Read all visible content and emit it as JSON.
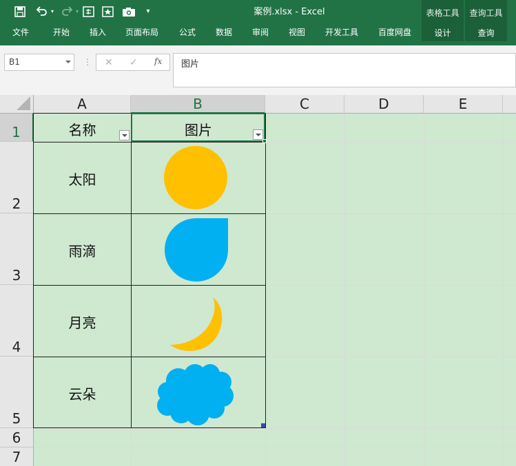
{
  "window": {
    "title": "案例.xlsx - Excel"
  },
  "quick_access": [
    "save-icon",
    "undo-icon",
    "redo-icon",
    "form-icon",
    "star-doc-icon",
    "camera-icon",
    "customize-icon"
  ],
  "ribbon": {
    "tabs": [
      "文件",
      "开始",
      "插入",
      "页面布局",
      "公式",
      "数据",
      "审阅",
      "视图",
      "开发工具",
      "百度网盘"
    ],
    "contextual": [
      {
        "group": "表格工具",
        "tab": "设计"
      },
      {
        "group": "查询工具",
        "tab": "查询"
      }
    ]
  },
  "formula_bar": {
    "name_box": "B1",
    "cancel_symbol": "✕",
    "enter_symbol": "✓",
    "fx_label": "fx",
    "content": "图片"
  },
  "sheet": {
    "columns": [
      "A",
      "B",
      "C",
      "D",
      "E"
    ],
    "rows": [
      "1",
      "2",
      "3",
      "4",
      "5",
      "6",
      "7"
    ],
    "selected_cell": "B1",
    "table": {
      "headers": [
        "名称",
        "图片"
      ],
      "rows": [
        {
          "name": "太阳",
          "picture": "sun-shape",
          "color": "#FFC000"
        },
        {
          "name": "雨滴",
          "picture": "raindrop-shape",
          "color": "#00B0F0"
        },
        {
          "name": "月亮",
          "picture": "moon-shape",
          "color": "#FFC000"
        },
        {
          "name": "云朵",
          "picture": "cloud-shape",
          "color": "#00B0F0"
        }
      ]
    },
    "colors": {
      "sheet_fill": "#CFE8D0",
      "accent": "#217346"
    }
  }
}
